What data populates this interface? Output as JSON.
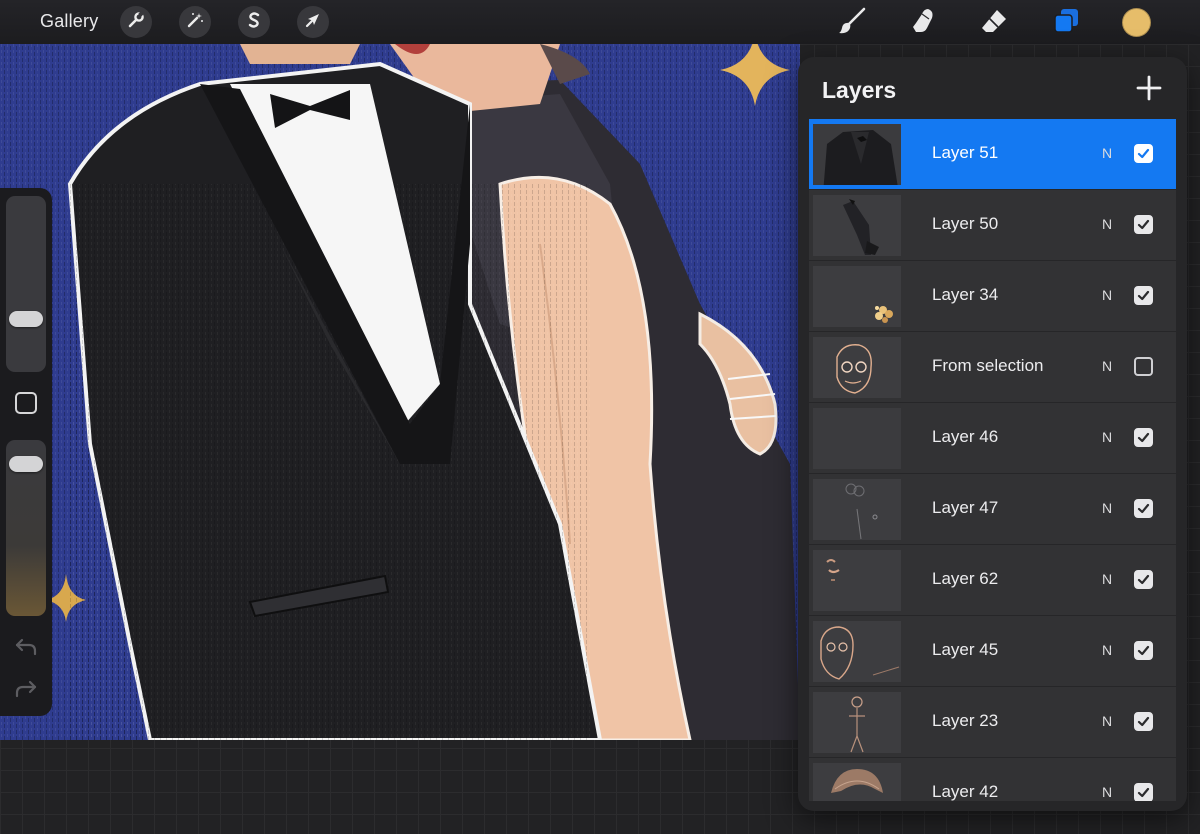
{
  "toolbar": {
    "gallery_label": "Gallery",
    "left_tools": [
      {
        "name": "actions",
        "icon": "wrench-icon"
      },
      {
        "name": "adjustments",
        "icon": "magic-wand-icon"
      },
      {
        "name": "selection",
        "icon": "selection-s-icon"
      },
      {
        "name": "transform",
        "icon": "arrow-cursor-icon"
      }
    ],
    "right_tools": [
      {
        "name": "brush",
        "icon": "brush-icon"
      },
      {
        "name": "smudge",
        "icon": "smudge-finger-icon"
      },
      {
        "name": "eraser",
        "icon": "eraser-icon"
      },
      {
        "name": "layers",
        "icon": "layers-icon",
        "active": true
      }
    ],
    "current_color": "#e6bd6a",
    "accent_color": "#1479f2"
  },
  "sidebar": {
    "brush_size_level": 0.27,
    "opacity_level": 0.92,
    "modify_icon": "square-modify-icon",
    "undo_icon": "undo-icon",
    "redo_icon": "redo-icon"
  },
  "layers_panel": {
    "title": "Layers",
    "add_icon": "plus-icon",
    "layers": [
      {
        "name": "Layer 51",
        "mode": "N",
        "visible": true,
        "selected": true,
        "thumb": "suit"
      },
      {
        "name": "Layer 50",
        "mode": "N",
        "visible": true,
        "selected": false,
        "thumb": "tie"
      },
      {
        "name": "Layer 34",
        "mode": "N",
        "visible": true,
        "selected": false,
        "thumb": "sparkle"
      },
      {
        "name": "From selection",
        "mode": "N",
        "visible": false,
        "selected": false,
        "thumb": "face-glasses"
      },
      {
        "name": "Layer 46",
        "mode": "N",
        "visible": true,
        "selected": false,
        "thumb": "blank"
      },
      {
        "name": "Layer 47",
        "mode": "N",
        "visible": true,
        "selected": false,
        "thumb": "faint-sketch"
      },
      {
        "name": "Layer 62",
        "mode": "N",
        "visible": true,
        "selected": false,
        "thumb": "small-marks"
      },
      {
        "name": "Layer 45",
        "mode": "N",
        "visible": true,
        "selected": false,
        "thumb": "face-outline"
      },
      {
        "name": "Layer 23",
        "mode": "N",
        "visible": true,
        "selected": false,
        "thumb": "figure-sketch"
      },
      {
        "name": "Layer 42",
        "mode": "N",
        "visible": true,
        "selected": false,
        "thumb": "hair"
      }
    ]
  }
}
